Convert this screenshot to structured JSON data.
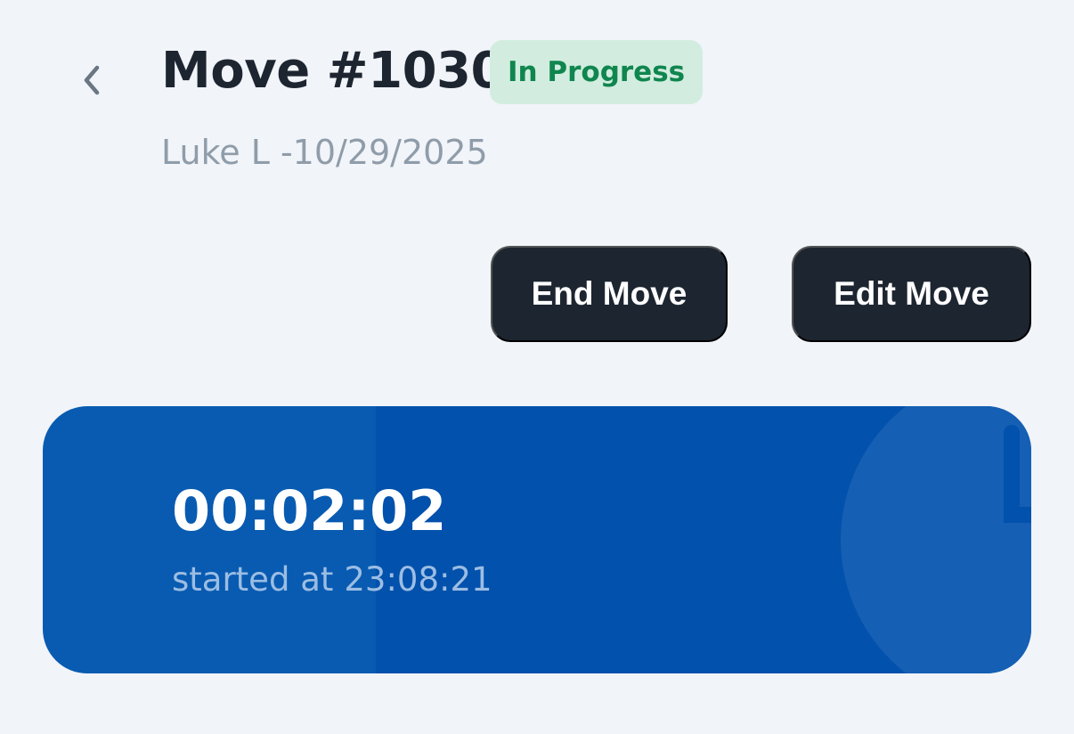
{
  "header": {
    "title": "Move #1030",
    "status": "In Progress",
    "subtitle": "Luke L -10/29/2025",
    "back_icon": "chevron-left-icon"
  },
  "actions": {
    "end_label": "End Move",
    "edit_label": "Edit Move"
  },
  "timer": {
    "elapsed": "00:02:02",
    "started_label": "started at",
    "started_time": "23:08:21",
    "icon": "clock-icon"
  },
  "colors": {
    "page_background": "#f1f4f9",
    "title_text": "#1d2530",
    "status_badge_bg": "#d2ede0",
    "status_badge_text": "#10864f",
    "subtitle_text": "#8f9ca9",
    "button_bg": "#1d2530",
    "button_text": "#ffffff",
    "timer_card_bg": "#0251ac",
    "timer_card_bg_light": "#085bb1",
    "timer_subtext": "#9cbde3"
  }
}
